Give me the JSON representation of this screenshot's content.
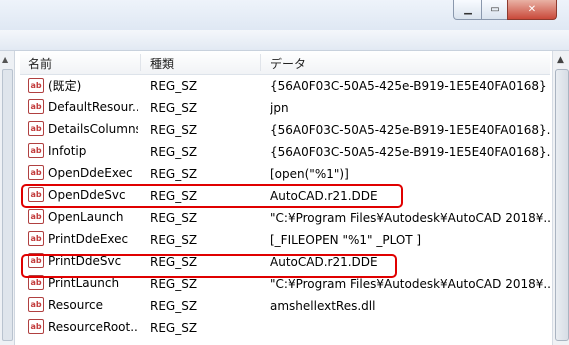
{
  "window": {
    "min_icon": "minimize-icon",
    "max_icon": "maximize-icon",
    "close_icon": "close-icon"
  },
  "columns": {
    "name": "名前",
    "type": "種類",
    "data": "データ"
  },
  "rows": [
    {
      "name": "(既定)",
      "type": "REG_SZ",
      "data": "{56A0F03C-50A5-425e-B919-1E5E40FA0168}"
    },
    {
      "name": "DefaultResour...",
      "type": "REG_SZ",
      "data": "jpn"
    },
    {
      "name": "DetailsColumns",
      "type": "REG_SZ",
      "data": "{56A0F03C-50A5-425e-B919-1E5E40FA0168}..."
    },
    {
      "name": "Infotip",
      "type": "REG_SZ",
      "data": "{56A0F03C-50A5-425e-B919-1E5E40FA0168}..."
    },
    {
      "name": "OpenDdeExec",
      "type": "REG_SZ",
      "data": "[open(\"%1\")]"
    },
    {
      "name": "OpenDdeSvc",
      "type": "REG_SZ",
      "data": "AutoCAD.r21.DDE"
    },
    {
      "name": "OpenLaunch",
      "type": "REG_SZ",
      "data": "\"C:¥Program Files¥Autodesk¥AutoCAD 2018¥..."
    },
    {
      "name": "PrintDdeExec",
      "type": "REG_SZ",
      "data": "[_FILEOPEN \"%1\" _PLOT ]"
    },
    {
      "name": "PrintDdeSvc",
      "type": "REG_SZ",
      "data": "AutoCAD.r21.DDE"
    },
    {
      "name": "PrintLaunch",
      "type": "REG_SZ",
      "data": "\"C:¥Program Files¥Autodesk¥AutoCAD 2018¥..."
    },
    {
      "name": "Resource",
      "type": "REG_SZ",
      "data": "amshellextRes.dll"
    },
    {
      "name": "ResourceRoot...",
      "type": "REG_SZ",
      "data": ""
    }
  ],
  "value_icon": {
    "text": "ab",
    "name": "string-value-icon"
  },
  "highlight_color": "#e00000"
}
